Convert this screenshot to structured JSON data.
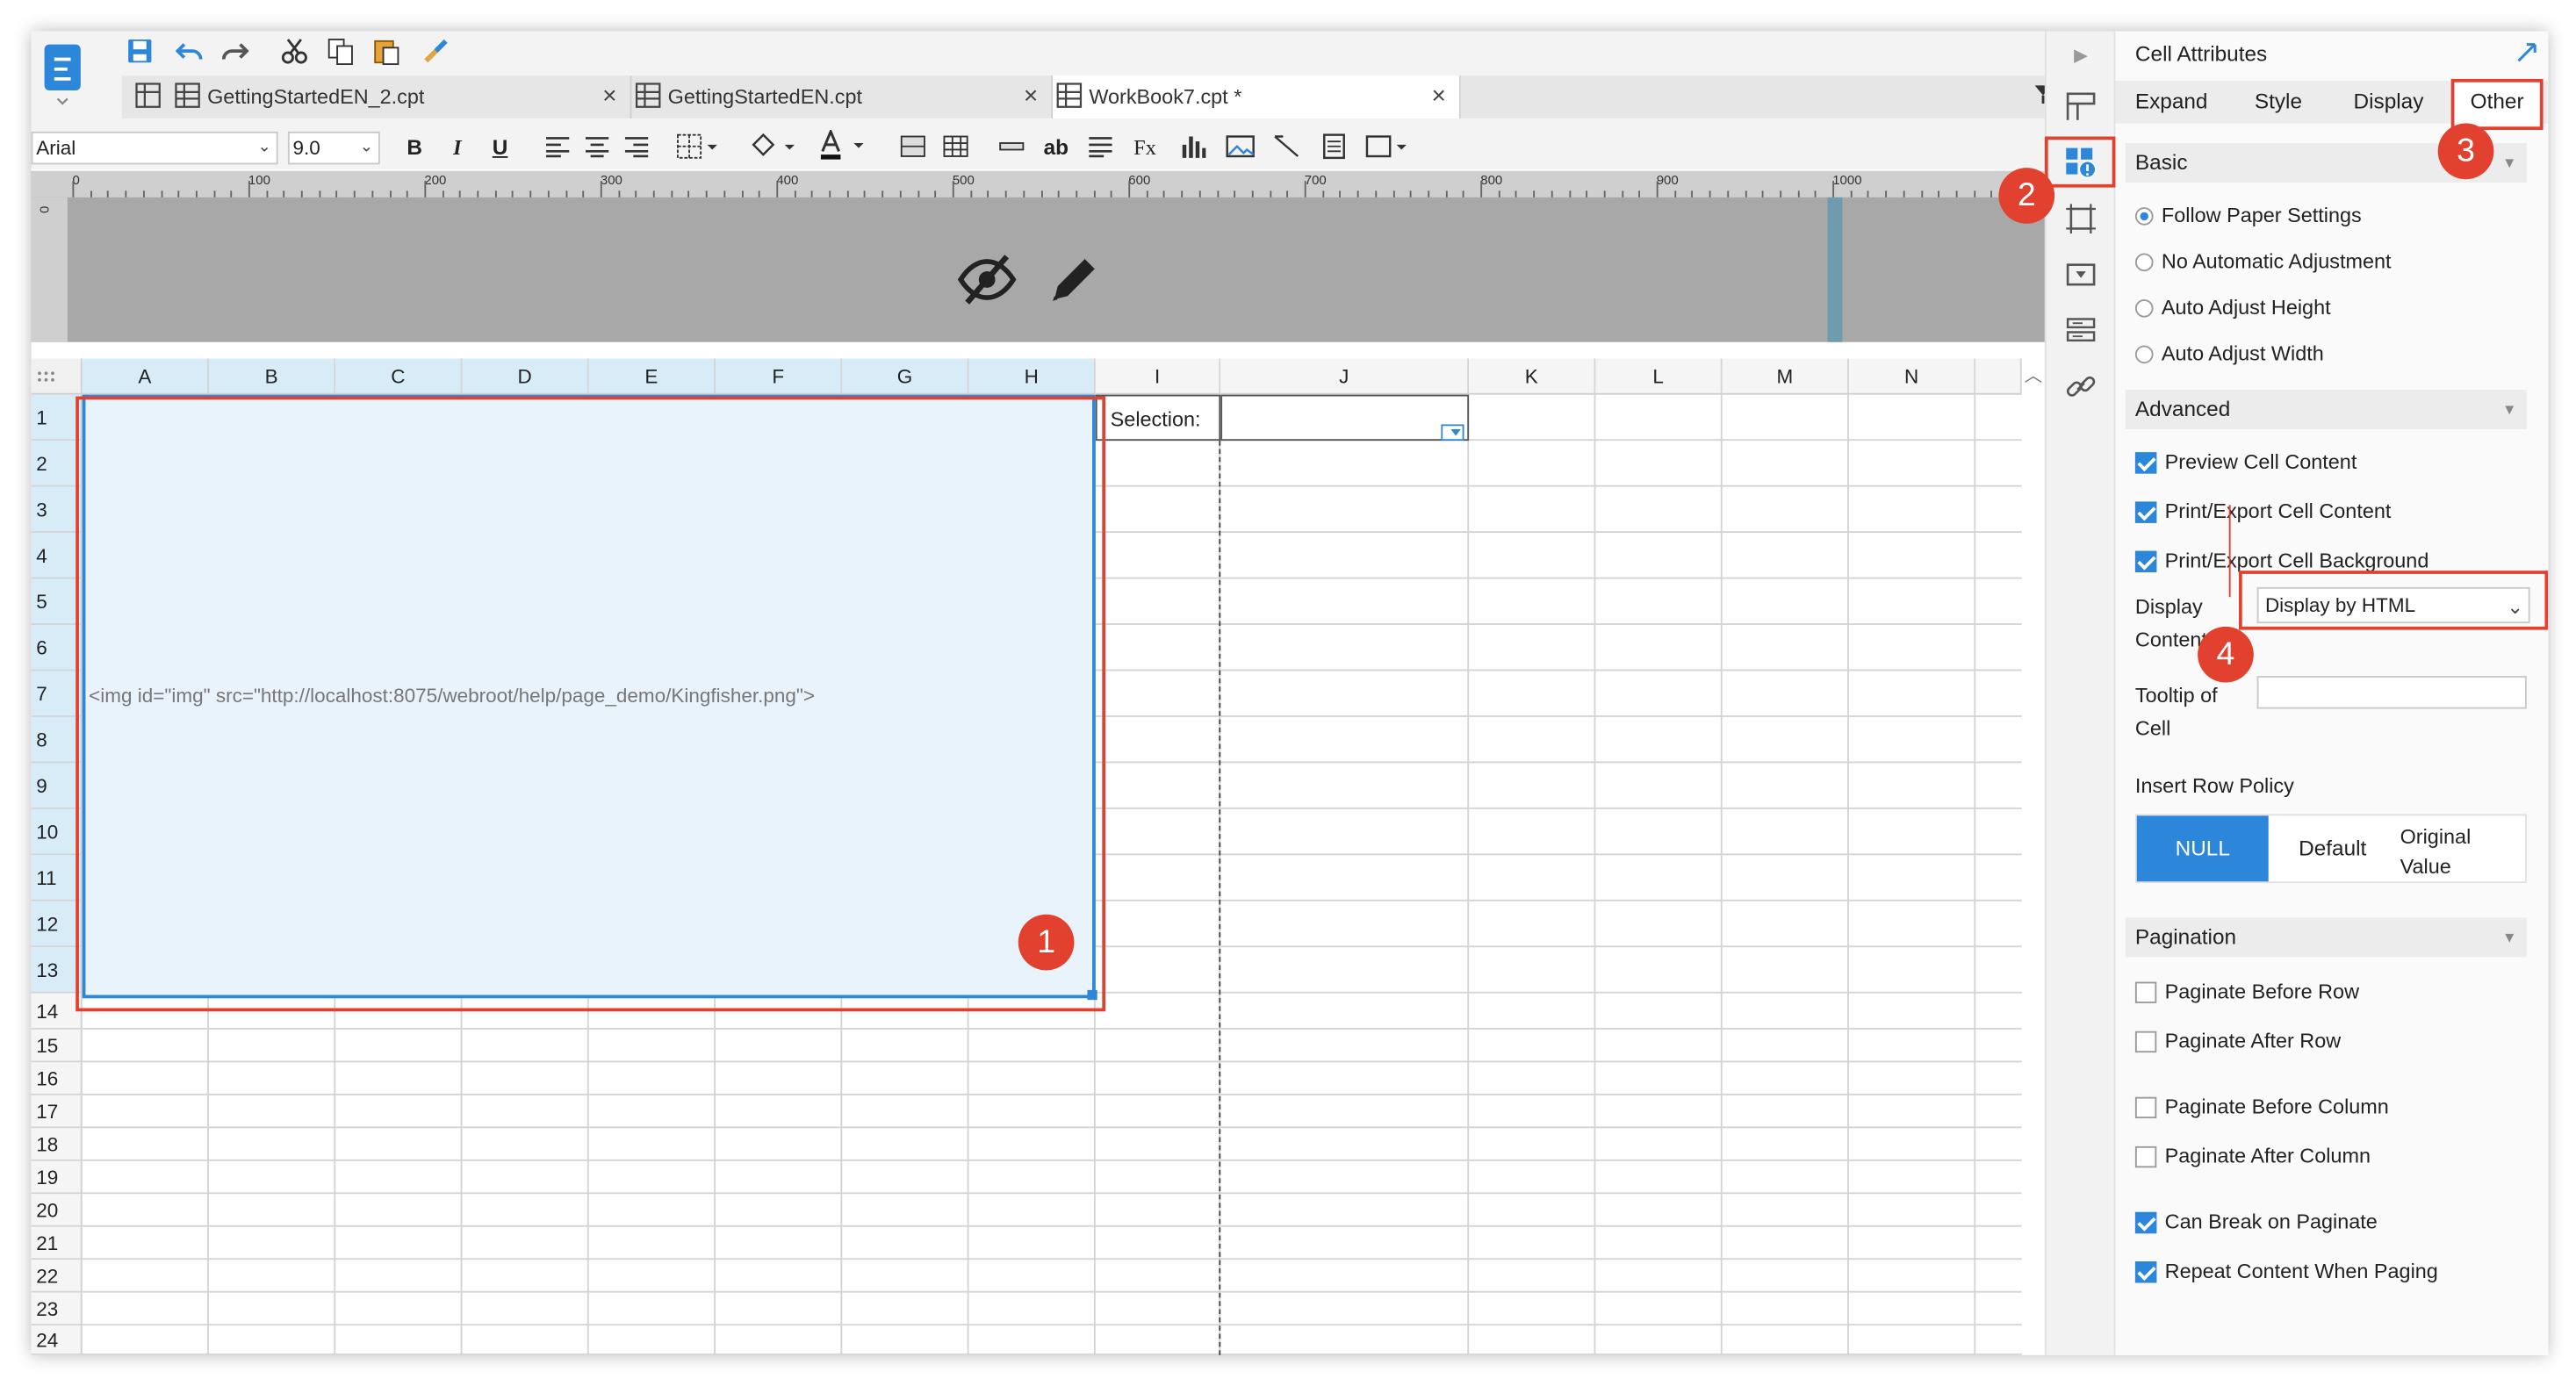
{
  "app": {
    "file_tabs": [
      {
        "label": "GettingStartedEN_2.cpt",
        "close": "×"
      },
      {
        "label": "GettingStartedEN.cpt",
        "close": "×"
      },
      {
        "label": "WorkBook7.cpt *",
        "close": "×"
      }
    ]
  },
  "format_bar": {
    "font_name": "Arial",
    "font_size": "9.0",
    "bold": "B",
    "italic": "I",
    "underline": "U",
    "text_direction": "ab",
    "formula": "Fx"
  },
  "ruler": {
    "labels": [
      "0",
      "100",
      "200",
      "300",
      "400",
      "500",
      "600",
      "700",
      "800",
      "900",
      "1000"
    ],
    "vertical_label": "0"
  },
  "sheet": {
    "columns": [
      "A",
      "B",
      "C",
      "D",
      "E",
      "F",
      "G",
      "H",
      "I",
      "J",
      "K",
      "L",
      "M",
      "N"
    ],
    "rows": [
      "1",
      "2",
      "3",
      "4",
      "5",
      "6",
      "7",
      "8",
      "9",
      "10",
      "11",
      "12",
      "13",
      "14",
      "15",
      "16",
      "17",
      "18",
      "19",
      "20",
      "21",
      "22",
      "23",
      "24"
    ],
    "merged_cell_content": "<img id=\"img\" src=\"http://localhost:8075/webroot/help/page_demo/Kingfisher.png\">",
    "selection_label": "Selection:"
  },
  "panel": {
    "title": "Cell Attributes",
    "tabs": [
      "Expand",
      "Style",
      "Display",
      "Other"
    ],
    "active_tab": "Other",
    "basic": {
      "title": "Basic",
      "options": [
        "Follow Paper Settings",
        "No Automatic Adjustment",
        "Auto Adjust Height",
        "Auto Adjust Width"
      ],
      "selected": "Follow Paper Settings"
    },
    "advanced": {
      "title": "Advanced",
      "checks": [
        {
          "label": "Preview Cell Content",
          "checked": true
        },
        {
          "label": "Print/Export Cell Content",
          "checked": true
        },
        {
          "label": "Print/Export Cell Background",
          "checked": true
        }
      ],
      "display_content_label_1": "Display",
      "display_content_label_2": "Content",
      "display_content_value": "Display by HTML",
      "tooltip_label_1": "Tooltip of",
      "tooltip_label_2": "Cell",
      "tooltip_value": ""
    },
    "insert_row_policy": {
      "title": "Insert Row Policy",
      "options": [
        "NULL",
        "Default",
        "Original Value"
      ],
      "original_line_1": "Original",
      "original_line_2": "Value",
      "selected": "NULL"
    },
    "pagination": {
      "title": "Pagination",
      "checks": [
        {
          "label": "Paginate Before Row",
          "checked": false
        },
        {
          "label": "Paginate After Row",
          "checked": false
        },
        {
          "label": "Paginate Before Column",
          "checked": false
        },
        {
          "label": "Paginate After Column",
          "checked": false
        },
        {
          "label": "Can Break on Paginate",
          "checked": true
        },
        {
          "label": "Repeat Content When Paging",
          "checked": true
        }
      ]
    }
  },
  "annotations": [
    "1",
    "2",
    "3",
    "4"
  ],
  "colors": {
    "accent": "#2c86d9",
    "annotation": "#e2412f",
    "selection_fill": "#e8f3fc",
    "ruler_bg": "#a8a8a8"
  },
  "icons": [
    "app-logo-icon",
    "save-icon",
    "undo-icon",
    "redo-icon",
    "cut-icon",
    "copy-icon",
    "paste-icon",
    "format-painter-icon",
    "hide-icon",
    "edit-pencil-icon",
    "cell-attributes-icon",
    "float-element-icon",
    "widget-icon",
    "condition-icon",
    "hyperlink-icon"
  ]
}
